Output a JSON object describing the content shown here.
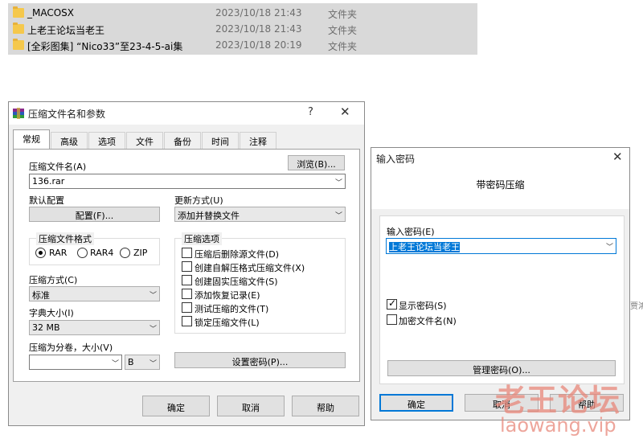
{
  "file_list": {
    "rows": [
      {
        "name": "_MACOSX",
        "date": "2023/10/18 21:43",
        "type": "文件夹"
      },
      {
        "name": "上老王论坛当老王",
        "date": "2023/10/18 21:43",
        "type": "文件夹"
      },
      {
        "name": "[全彩图集] “Nico33”至23-4-5-ai集",
        "date": "2023/10/18 20:19",
        "type": "文件夹"
      }
    ]
  },
  "archive_dialog": {
    "title": "压缩文件名和参数",
    "help_glyph": "?",
    "close_glyph": "✕",
    "tabs": [
      "常规",
      "高级",
      "选项",
      "文件",
      "备份",
      "时间",
      "注释"
    ],
    "archive_name_label": "压缩文件名(A)",
    "browse_label": "浏览(B)...",
    "archive_name_value": "136.rar",
    "default_config_label": "默认配置",
    "config_button": "配置(F)...",
    "update_mode_label": "更新方式(U)",
    "update_mode_value": "添加并替换文件",
    "format_group_title": "压缩文件格式",
    "format_options": [
      "RAR",
      "RAR4",
      "ZIP"
    ],
    "options_group_title": "压缩选项",
    "options": [
      {
        "label": "压缩后删除源文件(D)",
        "checked": false
      },
      {
        "label": "创建自解压格式压缩文件(X)",
        "checked": false
      },
      {
        "label": "创建固实压缩文件(S)",
        "checked": false
      },
      {
        "label": "添加恢复记录(E)",
        "checked": false
      },
      {
        "label": "测试压缩的文件(T)",
        "checked": false
      },
      {
        "label": "锁定压缩文件(L)",
        "checked": false
      }
    ],
    "method_label": "压缩方式(C)",
    "method_value": "标准",
    "dict_label": "字典大小(I)",
    "dict_value": "32 MB",
    "split_label": "压缩为分卷，大小(V)",
    "split_value": "",
    "split_unit": "B",
    "set_password_button": "设置密码(P)...",
    "ok_button": "确定",
    "cancel_button": "取消",
    "help_button": "帮助"
  },
  "password_dialog": {
    "title": "输入密码",
    "close_glyph": "✕",
    "heading": "带密码压缩",
    "password_label": "输入密码(E)",
    "password_value": "上老王论坛当老王",
    "show_password_label": "显示密码(S)",
    "show_password_checked": true,
    "encrypt_names_label": "加密文件名(N)",
    "encrypt_names_checked": false,
    "manage_button": "管理密码(O)...",
    "ok_button": "确定",
    "cancel_button": "取消",
    "help_button": "帮助"
  },
  "background_fragment": "贾鴻",
  "watermark": {
    "line1": "老王论坛",
    "line2": "laowang.vip"
  }
}
